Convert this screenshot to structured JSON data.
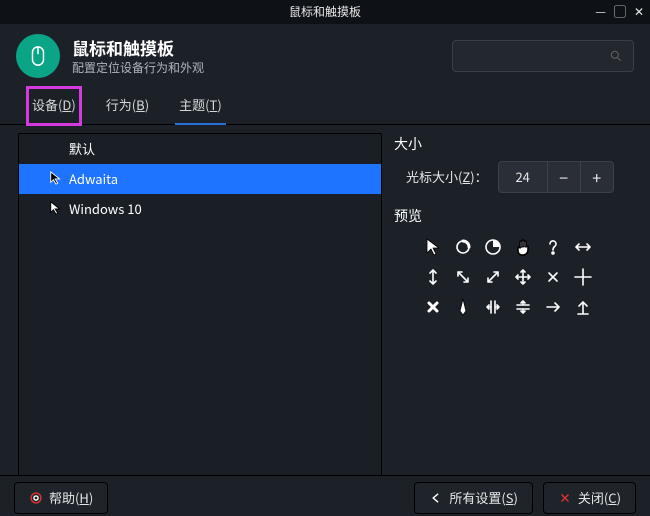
{
  "window": {
    "title": "鼠标和触摸板"
  },
  "header": {
    "title": "鼠标和触摸板",
    "subtitle": "配置定位设备行为和外观"
  },
  "search": {
    "placeholder": ""
  },
  "tabs": {
    "device": {
      "pre": "设备(",
      "u": "D",
      "post": ")"
    },
    "behavior": {
      "pre": "行为(",
      "u": "B",
      "post": ")"
    },
    "theme": {
      "pre": "主题(",
      "u": "T",
      "post": ")"
    }
  },
  "themes": {
    "items": [
      {
        "label": "默认"
      },
      {
        "label": "Adwaita"
      },
      {
        "label": "Windows 10"
      }
    ],
    "selected_index": 1
  },
  "size": {
    "section": "大小",
    "label_pre": "光标大小(",
    "label_u": "Z",
    "label_post": ")：",
    "value": "24"
  },
  "preview": {
    "section": "预览"
  },
  "footer": {
    "help_pre": "帮助(",
    "help_u": "H",
    "help_post": ")",
    "all_pre": "所有设置(",
    "all_u": "S",
    "all_post": ")",
    "close_pre": "关闭(",
    "close_u": "C",
    "close_post": ")"
  }
}
